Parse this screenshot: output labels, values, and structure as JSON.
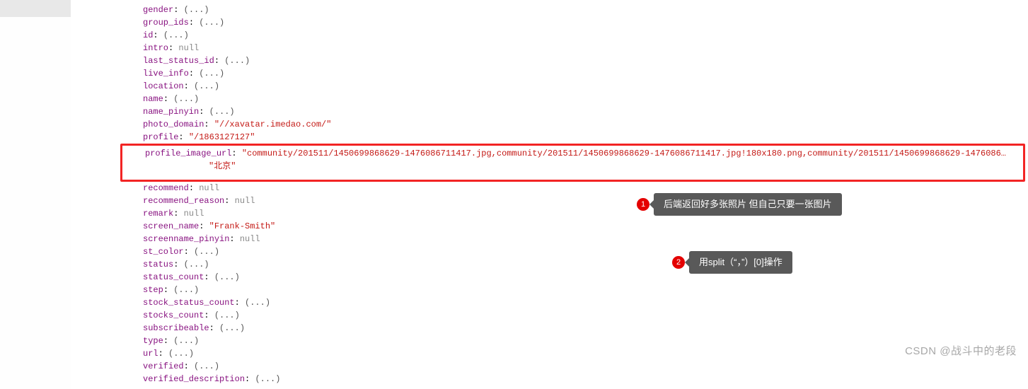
{
  "props": {
    "gender": {
      "key": "gender",
      "val": "(...)"
    },
    "group_ids": {
      "key": "group_ids",
      "val": "(...)"
    },
    "id": {
      "key": "id",
      "val": "(...)"
    },
    "intro": {
      "key": "intro",
      "val": "null"
    },
    "last_status_id": {
      "key": "last_status_id",
      "val": "(...)"
    },
    "live_info": {
      "key": "live_info",
      "val": "(...)"
    },
    "location": {
      "key": "location",
      "val": "(...)"
    },
    "name": {
      "key": "name",
      "val": "(...)"
    },
    "name_pinyin": {
      "key": "name_pinyin",
      "val": "(...)"
    },
    "photo_domain": {
      "key": "photo_domain",
      "val": "\"//xavatar.imedao.com/\""
    },
    "profile": {
      "key": "profile",
      "val": "\"/1863127127\""
    },
    "profile_image_url": {
      "key": "profile_image_url",
      "val": "\"community/201511/1450699868629-1476086711417.jpg,community/201511/1450699868629-1476086711417.jpg!180x180.png,community/201511/1450699868629-1476086…"
    },
    "extra_str": {
      "val": "\"北京\""
    },
    "recommend": {
      "key": "recommend",
      "val": "null"
    },
    "recommend_reason": {
      "key": "recommend_reason",
      "val": "null"
    },
    "remark": {
      "key": "remark",
      "val": "null"
    },
    "screen_name": {
      "key": "screen_name",
      "val": "\"Frank-Smith\""
    },
    "screenname_pinyin": {
      "key": "screenname_pinyin",
      "val": "null"
    },
    "st_color": {
      "key": "st_color",
      "val": "(...)"
    },
    "status": {
      "key": "status",
      "val": "(...)"
    },
    "status_count": {
      "key": "status_count",
      "val": "(...)"
    },
    "step": {
      "key": "step",
      "val": "(...)"
    },
    "stock_status_count": {
      "key": "stock_status_count",
      "val": "(...)"
    },
    "stocks_count": {
      "key": "stocks_count",
      "val": "(...)"
    },
    "subscribeable": {
      "key": "subscribeable",
      "val": "(...)"
    },
    "type": {
      "key": "type",
      "val": "(...)"
    },
    "url": {
      "key": "url",
      "val": "(...)"
    },
    "verified": {
      "key": "verified",
      "val": "(...)"
    },
    "verified_description": {
      "key": "verified_description",
      "val": "(...)"
    }
  },
  "annotations": {
    "a1": {
      "num": "1",
      "text": "后端返回好多张照片  但自己只要一张图片"
    },
    "a2": {
      "num": "2",
      "text": "用split（“，”）[0]操作"
    }
  },
  "watermark": "CSDN @战斗中的老段"
}
